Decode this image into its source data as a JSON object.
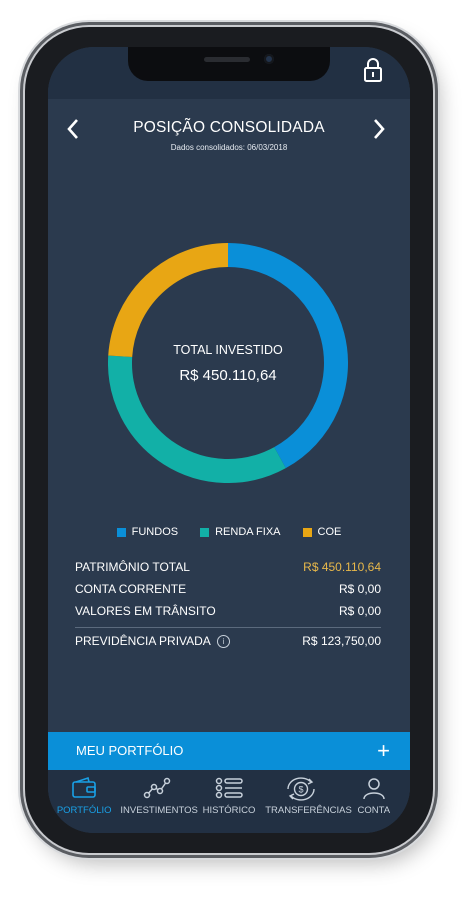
{
  "header": {
    "title": "POSIÇÃO CONSOLIDADA",
    "subtitle": "Dados consolidados: 06/03/2018"
  },
  "chart_data": {
    "type": "pie",
    "categories": [
      "FUNDOS",
      "RENDA FIXA",
      "COE"
    ],
    "values": [
      42,
      34,
      24
    ],
    "colors": [
      "#0a8fd8",
      "#12b0a7",
      "#e8a614"
    ],
    "center_title": "TOTAL INVESTIDO",
    "center_value": "R$ 450.110,64"
  },
  "summary": {
    "patrimonio_label": "PATRIMÔNIO TOTAL",
    "patrimonio_value": "R$ 450.110,64",
    "conta_label": "CONTA CORRENTE",
    "conta_value": "R$ 0,00",
    "transito_label": "VALORES EM TRÂNSITO",
    "transito_value": "R$ 0,00",
    "previdencia_label": "PREVIDÊNCIA PRIVADA",
    "previdencia_value": "R$ 123,750,00",
    "highlight_color": "#e8b84a"
  },
  "portfolio_bar": {
    "label": "MEU PORTFÓLIO"
  },
  "tabs": [
    {
      "label": "PORTFÓLIO",
      "icon": "wallet-icon",
      "active": true
    },
    {
      "label": "INVESTIMENTOS",
      "icon": "line-chart-icon",
      "active": false
    },
    {
      "label": "HISTÓRICO",
      "icon": "list-icon",
      "active": false
    },
    {
      "label": "TRANSFERÊNCIAS",
      "icon": "transfer-icon",
      "active": false
    },
    {
      "label": "CONTA",
      "icon": "user-icon",
      "active": false
    }
  ]
}
